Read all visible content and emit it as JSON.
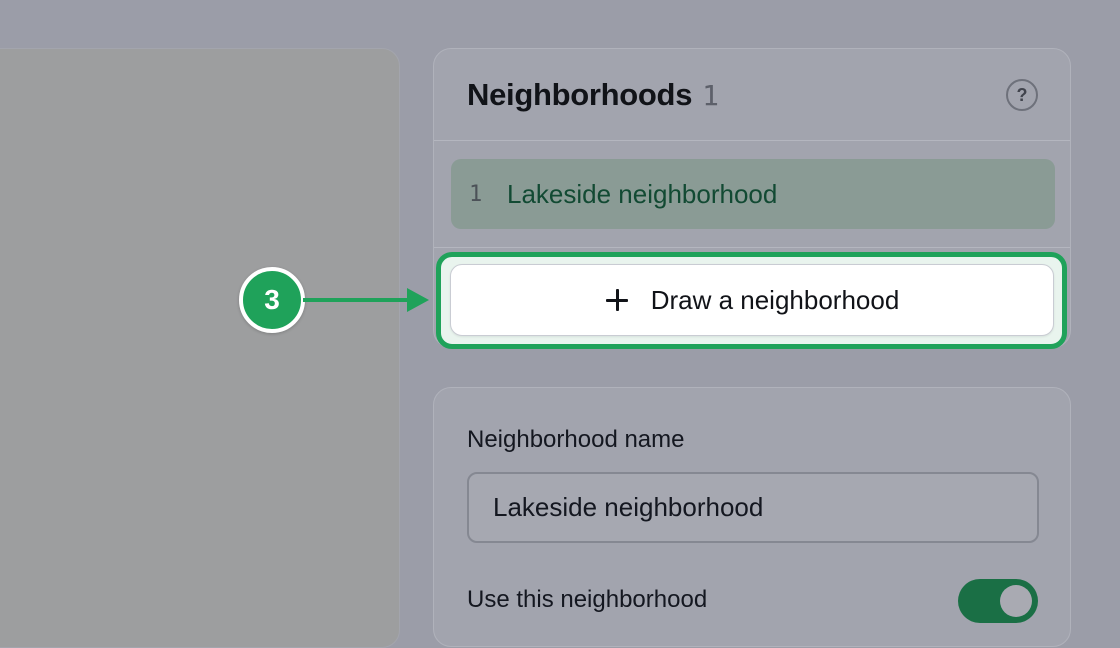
{
  "neighborhoods_panel": {
    "title": "Neighborhoods",
    "count": "1",
    "help_icon": "question-circle-icon",
    "help_text": "?",
    "items": [
      {
        "number": "1",
        "label": "Lakeside neighborhood"
      }
    ],
    "draw_button": {
      "icon": "plus-icon",
      "label": "Draw a neighborhood"
    }
  },
  "tutorial": {
    "step_number": "3",
    "accent_color": "#1fa25a"
  },
  "details_panel": {
    "name_label": "Neighborhood name",
    "name_value": "Lakeside neighborhood",
    "use_label": "Use this neighborhood",
    "use_enabled": true
  }
}
